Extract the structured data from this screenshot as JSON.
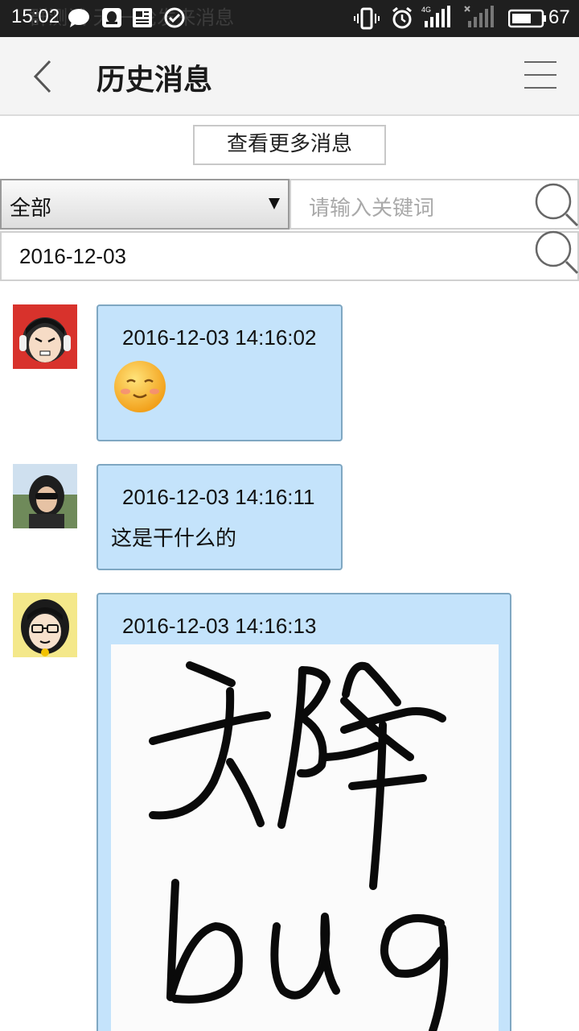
{
  "status_bar": {
    "time": "15:02",
    "notification_ghost": "群测试 天 一轮发来消息",
    "network_type": "4G",
    "battery": "67",
    "icons": [
      "chat-bubble-icon",
      "qq-icon",
      "news-icon",
      "check-circle-icon",
      "vibrate-icon",
      "alarm-icon",
      "signal-icon",
      "signal-muted-icon",
      "battery-icon"
    ]
  },
  "header": {
    "title": "历史消息",
    "back_icon": "back-arrow-icon",
    "menu_icon": "hamburger-menu-icon"
  },
  "more_button": {
    "label": "查看更多消息"
  },
  "filter": {
    "type_selected": "全部",
    "keyword_placeholder": "请输入关键词",
    "date_value": "2016-12-03"
  },
  "messages": [
    {
      "timestamp": "2016-12-03 14:16:02",
      "content_type": "emoji",
      "emoji": "blush-smile-emoji"
    },
    {
      "timestamp": "2016-12-03 14:16:11",
      "content_type": "text",
      "text": "这是干什么的"
    },
    {
      "timestamp": "2016-12-03 14:16:13",
      "content_type": "image",
      "image_text": "天降bug"
    }
  ],
  "colors": {
    "status_bar": "#1f1f1f",
    "header_bg": "#f4f4f4",
    "bubble_bg": "#c4e3fb",
    "bubble_border": "#7fa7c2",
    "placeholder": "#a9a9a9"
  }
}
